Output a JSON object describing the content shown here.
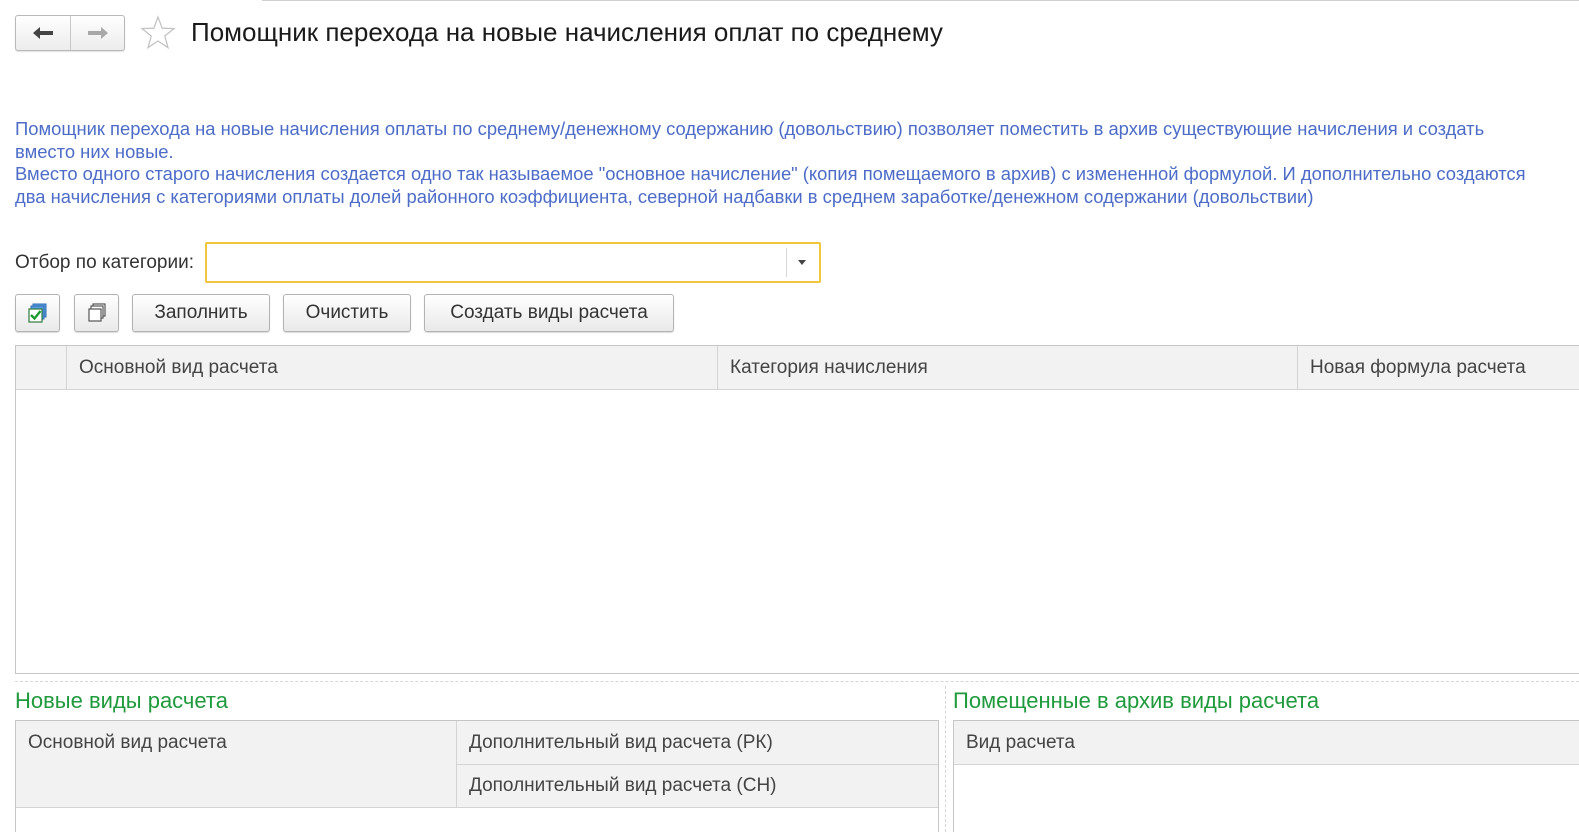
{
  "window": {
    "title": "Помощник перехода на новые начисления оплат по среднему"
  },
  "nav": {
    "back_icon": "arrow-left-icon",
    "forward_icon": "arrow-right-icon",
    "favorite_icon": "star-icon"
  },
  "info": {
    "paragraph1": "Помощник перехода на новые начисления оплаты по среднему/денежному содержанию (довольствию) позволяет поместить в архив существующие начисления и создать вместо них новые.",
    "paragraph2": "Вместо одного старого начисления создается одно так называемое \"основное начисление\" (копия помещаемого в архив) с измененной формулой. И дополнительно создаются два начисления с категориями оплаты долей районного коэффициента, северной надбавки в среднем заработке/денежном содержании (довольствии)",
    "color": "#4c6cc8"
  },
  "filter": {
    "label": "Отбор по категории:",
    "value": ""
  },
  "toolbar": {
    "check_all_icon": "check-all-icon",
    "uncheck_all_icon": "uncheck-all-icon",
    "fill_label": "Заполнить",
    "clear_label": "Очистить",
    "create_label": "Создать виды расчета"
  },
  "main_table": {
    "columns": [
      "Основной вид расчета",
      "Категория начисления",
      "Новая формула расчета"
    ],
    "rows": []
  },
  "new_types": {
    "title": "Новые виды расчета",
    "columns": {
      "main": "Основной вид расчета",
      "additional_rk": "Дополнительный вид расчета (РК)",
      "additional_sn": "Дополнительный вид расчета (СН)"
    }
  },
  "archived_types": {
    "title": "Помещенные в архив виды расчета",
    "columns": [
      "Вид расчета"
    ]
  },
  "colors": {
    "section_title": "#1f9a3c",
    "filter_border": "#f0c63c"
  }
}
